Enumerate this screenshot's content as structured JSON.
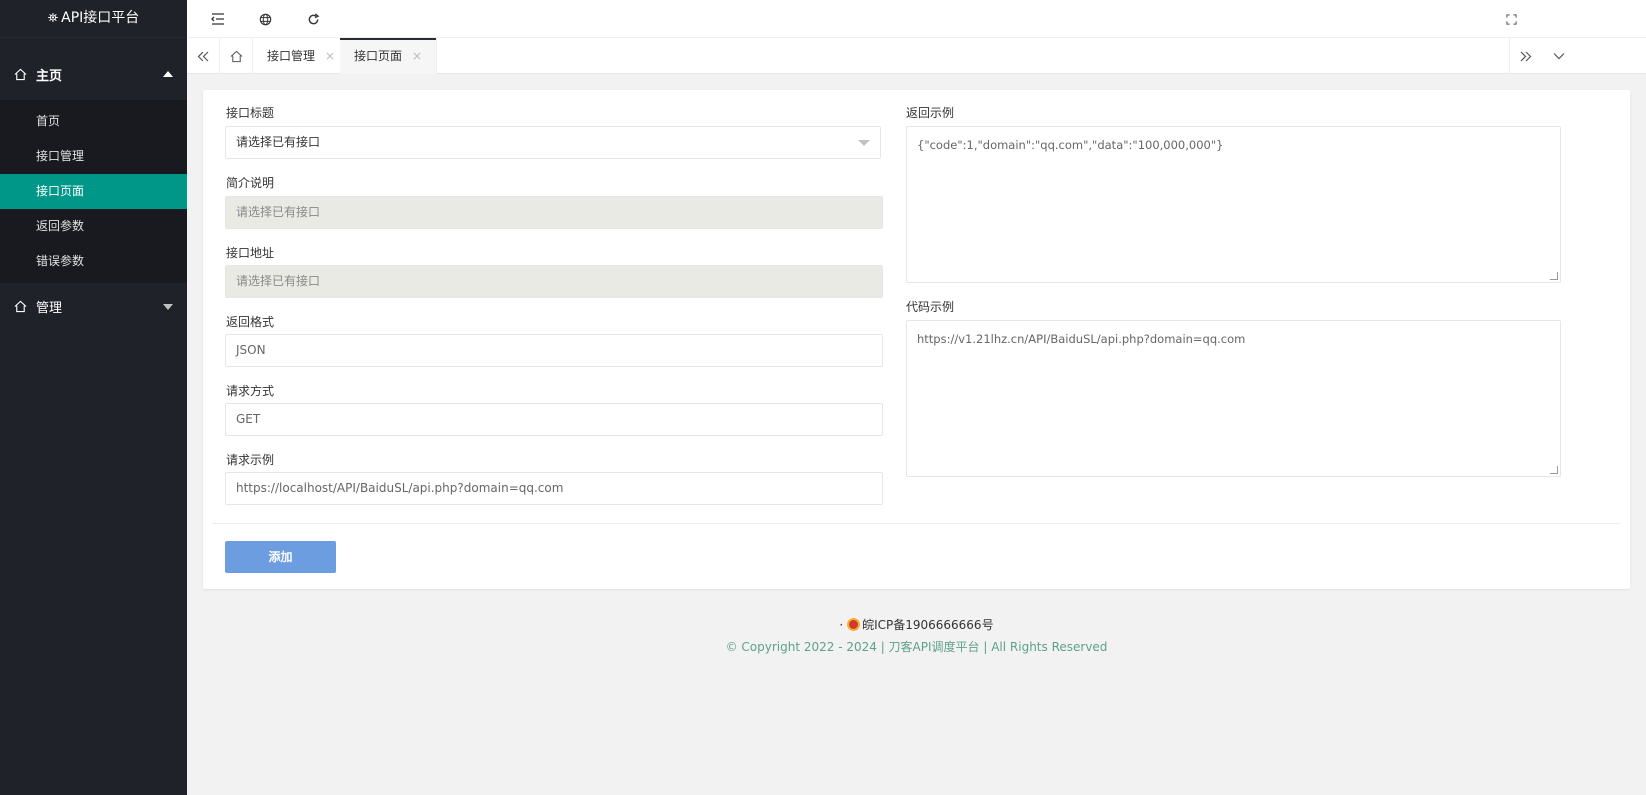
{
  "app": {
    "title": "API接口平台"
  },
  "sidebar": {
    "groups": [
      {
        "label": "主页",
        "icon": "home-icon",
        "expanded": true
      },
      {
        "label": "管理",
        "icon": "home-icon",
        "expanded": false
      }
    ],
    "items": [
      {
        "label": "首页",
        "active": false
      },
      {
        "label": "接口管理",
        "active": false
      },
      {
        "label": "接口页面",
        "active": true
      },
      {
        "label": "返回参数",
        "active": false
      },
      {
        "label": "错误参数",
        "active": false
      }
    ]
  },
  "topbar": {
    "icons": [
      "menu-toggle-icon",
      "globe-icon",
      "refresh-icon",
      "fullscreen-icon"
    ]
  },
  "tabs": {
    "items": [
      {
        "label": "接口管理",
        "active": false
      },
      {
        "label": "接口页面",
        "active": true
      }
    ],
    "close_glyph": "×"
  },
  "form": {
    "api_title": {
      "label": "接口标题",
      "value": "请选择已有接口"
    },
    "description": {
      "label": "简介说明",
      "value": "请选择已有接口"
    },
    "api_url": {
      "label": "接口地址",
      "value": "请选择已有接口"
    },
    "return_format": {
      "label": "返回格式",
      "value": "JSON"
    },
    "request_method": {
      "label": "请求方式",
      "value": "GET"
    },
    "request_example": {
      "label": "请求示例",
      "value": "https://localhost/API/BaiduSL/api.php?domain=qq.com"
    },
    "return_example": {
      "label": "返回示例",
      "value": "{\"code\":1,\"domain\":\"qq.com\",\"data\":\"100,000,000\"}"
    },
    "code_example": {
      "label": "代码示例",
      "value": "https://v1.21lhz.cn/API/BaiduSL/api.php?domain=qq.com"
    },
    "submit_label": "添加"
  },
  "footer": {
    "bullet": "·",
    "icp": "皖ICP备1906666666号",
    "copyright": "© Copyright 2022 - 2024 | 刀客API调度平台 | All Rights Reserved"
  },
  "colors": {
    "sidebar_bg": "#20222a",
    "active_item": "#009688",
    "button_primary": "#6c9de0",
    "footer_link": "#5fa08c"
  }
}
